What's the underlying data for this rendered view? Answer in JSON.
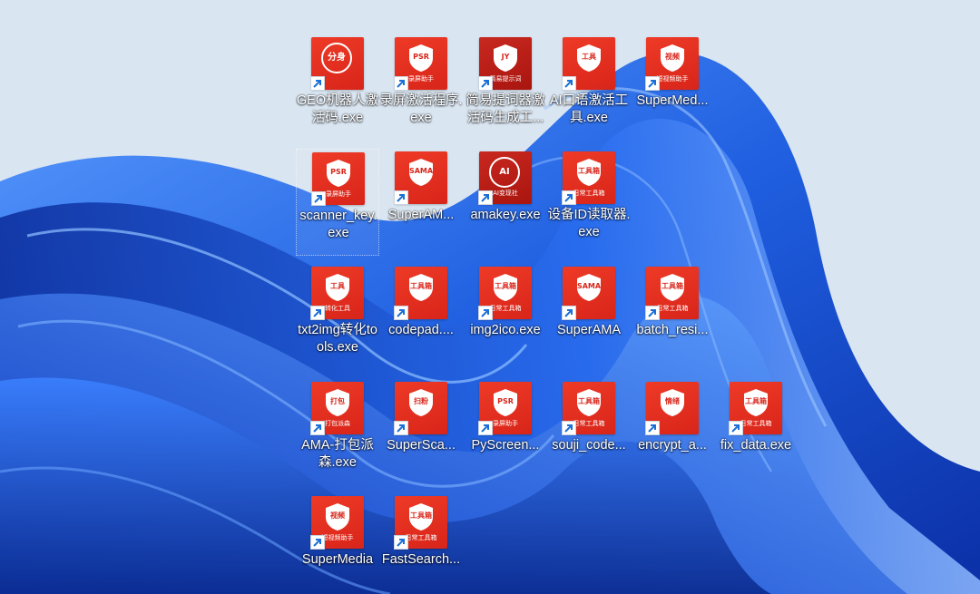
{
  "desktop": {
    "icons": [
      {
        "label": "GEO机器人激活码.exe",
        "glyph": "分身",
        "sub": "",
        "style": "circle"
      },
      {
        "label": "录屏激活程序.exe",
        "glyph": "PSR",
        "sub": "录屏助手",
        "style": "shield"
      },
      {
        "label": "简易提词器激活码生成工...",
        "glyph": "JY",
        "sub": "简易提示词",
        "style": "dark-shield"
      },
      {
        "label": "AI口语激活工具.exe",
        "glyph": "工具",
        "sub": "",
        "style": "shield"
      },
      {
        "label": "SuperMed...",
        "glyph": "视频",
        "sub": "短视频助手",
        "style": "shield"
      },
      {
        "label": "scanner_key.exe",
        "glyph": "PSR",
        "sub": "录屏助手",
        "style": "shield",
        "selected": true
      },
      {
        "label": "SuperAM...",
        "glyph": "SAMA",
        "sub": "",
        "style": "shield"
      },
      {
        "label": "amakey.exe",
        "glyph": "AI",
        "sub": "AI变现社",
        "style": "dark-circle"
      },
      {
        "label": "设备ID读取器.exe",
        "glyph": "工具箱",
        "sub": "日常工具箱",
        "style": "shield"
      },
      {
        "label": "txt2img转化tools.exe",
        "glyph": "工具",
        "sub": "转化工具",
        "style": "shield"
      },
      {
        "label": "codepad....",
        "glyph": "工具箱",
        "sub": "",
        "style": "shield"
      },
      {
        "label": "img2ico.exe",
        "glyph": "工具箱",
        "sub": "日常工具箱",
        "style": "shield"
      },
      {
        "label": "SuperAMA",
        "glyph": "SAMA",
        "sub": "",
        "style": "shield"
      },
      {
        "label": "batch_resi...",
        "glyph": "工具箱",
        "sub": "日常工具箱",
        "style": "shield"
      },
      {
        "label": "AMA-打包派森.exe",
        "glyph": "打包",
        "sub": "打包派森",
        "style": "shield"
      },
      {
        "label": "SuperSca...",
        "glyph": "扫粉",
        "sub": "",
        "style": "shield"
      },
      {
        "label": "PyScreen...",
        "glyph": "PSR",
        "sub": "录屏助手",
        "style": "shield"
      },
      {
        "label": "souji_code...",
        "glyph": "工具箱",
        "sub": "日常工具箱",
        "style": "shield"
      },
      {
        "label": "encrypt_a...",
        "glyph": "情绪",
        "sub": "",
        "style": "shield"
      },
      {
        "label": "fix_data.exe",
        "glyph": "工具箱",
        "sub": "日常工具箱",
        "style": "shield"
      },
      {
        "label": "SuperMedia",
        "glyph": "视频",
        "sub": "短视频助手",
        "style": "shield"
      },
      {
        "label": "FastSearch...",
        "glyph": "工具箱",
        "sub": "日常工具箱",
        "style": "shield"
      }
    ]
  },
  "colors": {
    "tile_red": "#e3301f",
    "tile_dark_red": "#b51a12",
    "wallpaper_blue": "#1f5fe0",
    "wallpaper_bg": "#d6e3ef"
  },
  "icon_names": {
    "shortcut_overlay": "shortcut-arrow-icon"
  }
}
